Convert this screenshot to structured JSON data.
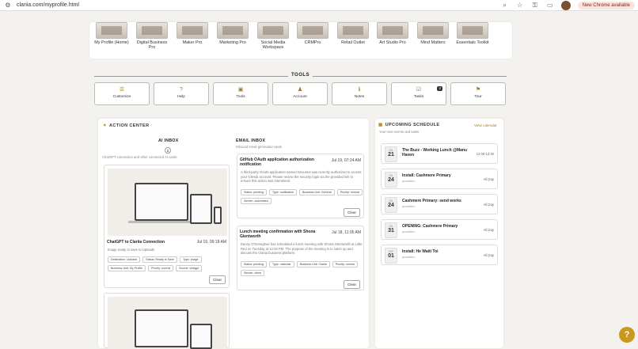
{
  "browser": {
    "url": "clariia.com/myprofile.html",
    "new_chrome_label": "New Chrome available"
  },
  "workspaces": [
    {
      "label": "My Profile (Home)"
    },
    {
      "label": "Digital Business Pro"
    },
    {
      "label": "Maker Pro"
    },
    {
      "label": "Marketing Pro"
    },
    {
      "label": "Social Media Workspace"
    },
    {
      "label": "CRMPro"
    },
    {
      "label": "Retail Outlet"
    },
    {
      "label": "Art Studio Pro"
    },
    {
      "label": "Mind Matters"
    },
    {
      "label": "Essentials Toolkit"
    }
  ],
  "tools": {
    "title": "TOOLS",
    "items": [
      {
        "label": "Customize",
        "icon": "sliders-icon"
      },
      {
        "label": "Help",
        "icon": "help-icon"
      },
      {
        "label": "Tools",
        "icon": "toolbox-icon"
      },
      {
        "label": "Account",
        "icon": "person-icon"
      },
      {
        "label": "Notes",
        "icon": "info-icon"
      },
      {
        "label": "Tasks",
        "icon": "checklist-icon",
        "badge": "2"
      },
      {
        "label": "Tour",
        "icon": "tour-icon"
      }
    ]
  },
  "action_center": {
    "title": "ACTION CENTER",
    "ai_inbox": {
      "title": "AI INBOX",
      "count": "2",
      "subtitle": "ChatGPT connection and other connected AI cards",
      "card": {
        "title": "ChatGPT to Clariia Connection",
        "date": "Jul 19, 09:18 AM",
        "desc": "Image ready to save to Uploads",
        "tags": [
          "Destination: Uploads",
          "Status: Ready to Save",
          "Type: image",
          "Business Unit: My Profile",
          "Priority: normal",
          "Source: chatgpt"
        ],
        "clear": "Clear"
      }
    },
    "email_inbox": {
      "title": "EMAIL INBOX",
      "subtitle": "Inbound email-generated cards",
      "cards": [
        {
          "title": "GitHub OAuth application authorization notification",
          "date": "Jul 19, 07:24 AM",
          "desc": "A third-party OAuth application named Devused was recently authorized to access your GitHub account. Please review the security login via the provided link to ensure this action was intentional.",
          "tags": [
            "Status: pending",
            "Type: notification",
            "Business Unit: General",
            "Priority: normal",
            "Sender: automated"
          ],
          "clear": "Clear"
        },
        {
          "title": "Lunch meeting confirmation with Shona Glentworth",
          "date": "Jul 18, 11:05 AM",
          "desc": "Danny O'Donoghue has scheduled a lunch meeting with Shona Glentworth at Little Red on Tuesday at 12:00 PM. The purpose of the meeting is to catch up and discuss the Clariia business platform.",
          "tags": [
            "Status: pending",
            "Type: calendar",
            "Business Unit: Clariia",
            "Priority: normal",
            "Sender: client"
          ],
          "clear": "Clear"
        }
      ]
    }
  },
  "schedule": {
    "title": "UPCOMING SCHEDULE",
    "subtitle": "Your next events and tasks",
    "view_calendar": "View calendar",
    "events": [
      {
        "month": "JUL",
        "day": "21",
        "title": "The Buzz - Working Lunch @Manu Haven",
        "sub": "",
        "time": "12:00-13:30"
      },
      {
        "month": "JUL",
        "day": "24",
        "title": "Install: Cashmere Primary",
        "sub": "quotation",
        "time": "All Day"
      },
      {
        "month": "JUL",
        "day": "24",
        "title": "Cashmere Primary: send works",
        "sub": "quotation",
        "time": "All Day"
      },
      {
        "month": "JUL",
        "day": "31",
        "title": "OPENING: Cashmere Primary",
        "sub": "quotation",
        "time": "All Day"
      },
      {
        "month": "SEP",
        "day": "01",
        "title": "Install: He Waiti Toi",
        "sub": "quotation",
        "time": "All Day"
      }
    ]
  },
  "help_fab": "?"
}
